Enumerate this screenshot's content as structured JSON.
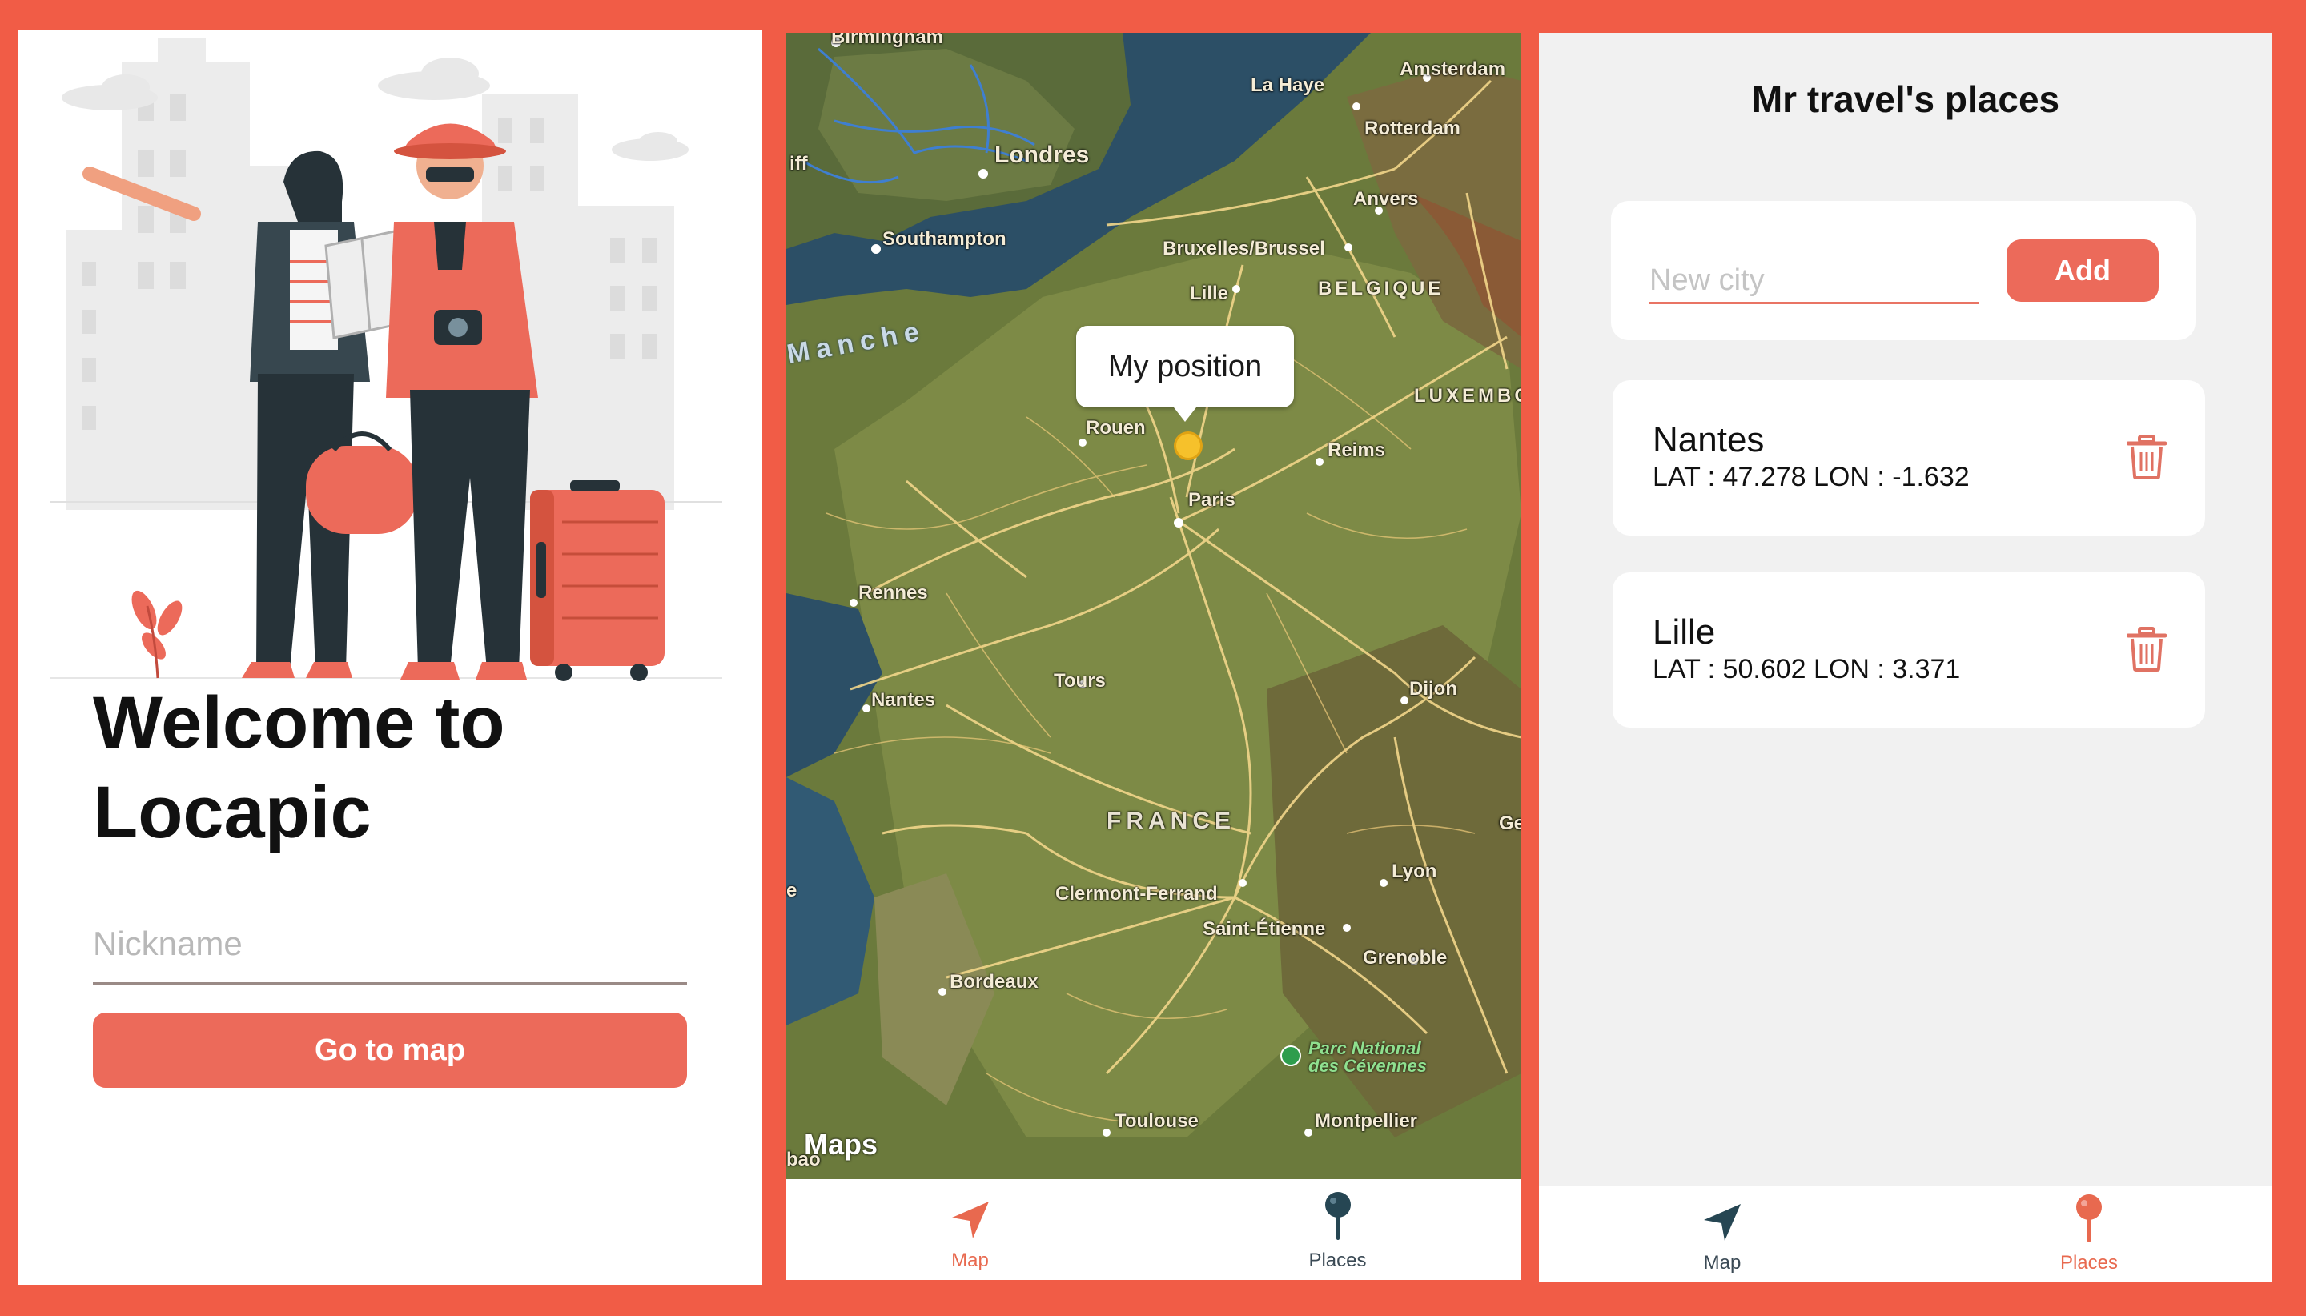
{
  "colors": {
    "frame": "#f15c46",
    "accent": "#ec6a5a",
    "tab_active": "#e8694f",
    "tab_inactive": "#3b4a55",
    "background_light": "#f1f1f1"
  },
  "login": {
    "welcome_line1": "Welcome to",
    "welcome_line2": "Locapic",
    "nickname_placeholder": "Nickname",
    "nickname_value": "",
    "go_button": "Go to map"
  },
  "map": {
    "callout": "My position",
    "logo": "Maps",
    "labels": {
      "birmingham": "Birmingham",
      "la_haye": "La Haye",
      "amsterdam": "Amsterdam",
      "londres": "Londres",
      "rotterdam": "Rotterdam",
      "iff": "iff",
      "anvers": "Anvers",
      "southampton": "Southampton",
      "bruxelles": "Bruxelles/Brussel",
      "lille": "Lille",
      "belgique": "BELGIQUE",
      "manche": "Manche",
      "luxembo": "LUXEMBO",
      "rouen": "Rouen",
      "reims": "Reims",
      "paris": "Paris",
      "rennes": "Rennes",
      "tours": "Tours",
      "dijon": "Dijon",
      "nantes": "Nantes",
      "france": "FRANCE",
      "lyon": "Lyon",
      "clermont": "Clermont-Ferrand",
      "saint_etienne": "Saint-Étienne",
      "grenoble": "Grenoble",
      "bordeaux": "Bordeaux",
      "parc_line1": "Parc National",
      "parc_line2": "des Cévennes",
      "toulouse": "Toulouse",
      "montpellier": "Montpellier",
      "e": "e",
      "ge": "Ge",
      "bao": "bao"
    }
  },
  "tabs": {
    "map": "Map",
    "places": "Places"
  },
  "places": {
    "title": "Mr travel's places",
    "new_city_placeholder": "New city",
    "new_city_value": "",
    "add_button": "Add",
    "items": [
      {
        "name": "Nantes",
        "coords": "LAT : 47.278 LON : -1.632"
      },
      {
        "name": "Lille",
        "coords": "LAT : 50.602 LON : 3.371"
      }
    ]
  }
}
